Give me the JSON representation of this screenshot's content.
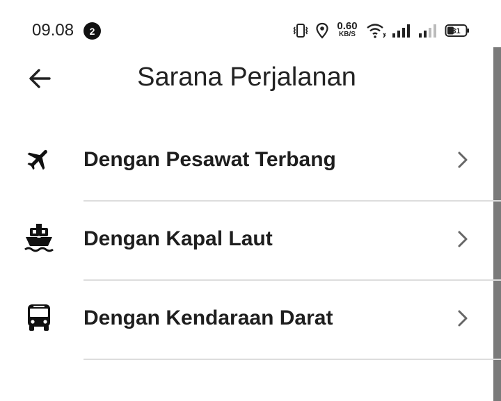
{
  "status_bar": {
    "time": "09.08",
    "notification_count": "2",
    "network_speed": "0.60",
    "network_speed_unit": "KB/S",
    "battery": "31"
  },
  "app_bar": {
    "title": "Sarana Perjalanan",
    "back_icon": "arrow-left-icon"
  },
  "menu": [
    {
      "label": "Dengan Pesawat Terbang",
      "icon": "airplane-icon"
    },
    {
      "label": "Dengan Kapal Laut",
      "icon": "ship-icon"
    },
    {
      "label": "Dengan Kendaraan Darat",
      "icon": "bus-icon"
    }
  ],
  "colors": {
    "background": "#ffffff",
    "text": "#222222",
    "divider": "#dddddd",
    "chevron": "#666666"
  }
}
